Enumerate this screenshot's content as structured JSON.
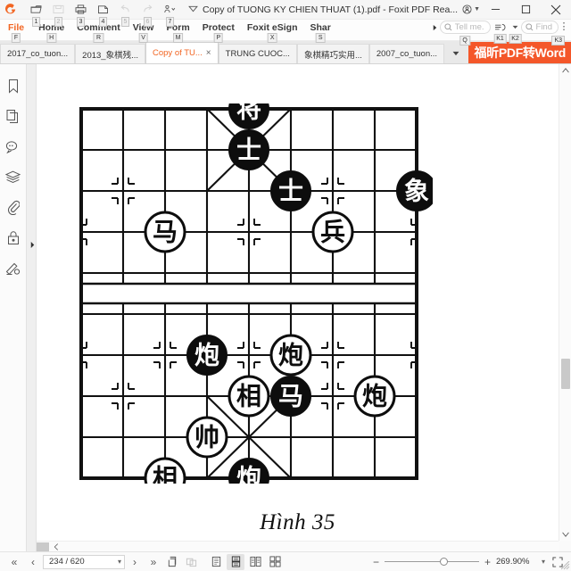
{
  "window": {
    "title": "Copy of TUONG KY CHIEN THUAT (1).pdf - Foxit PDF Rea...",
    "logo": "foxit-logo",
    "minimize": "—",
    "maximize": "□",
    "close": "×"
  },
  "quick_access": [
    {
      "name": "open-file",
      "keytip": "1",
      "enabled": true
    },
    {
      "name": "save-as",
      "keytip": "2",
      "enabled": false
    },
    {
      "name": "print",
      "keytip": "3",
      "enabled": true
    },
    {
      "name": "email",
      "keytip": "4",
      "enabled": true
    },
    {
      "name": "undo",
      "keytip": "5",
      "enabled": false
    },
    {
      "name": "redo",
      "keytip": "6",
      "enabled": false
    },
    {
      "name": "customize",
      "keytip": "7",
      "enabled": true
    }
  ],
  "menu": {
    "items": [
      {
        "label": "File",
        "keytip": "F",
        "active": true
      },
      {
        "label": "Home",
        "keytip": "H",
        "active": false
      },
      {
        "label": "Comment",
        "keytip": "R",
        "active": false
      },
      {
        "label": "View",
        "keytip": "V",
        "active": false
      },
      {
        "label": "Form",
        "keytip": "M",
        "active": false
      },
      {
        "label": "Protect",
        "keytip": "P",
        "active": false
      },
      {
        "label": "Foxit eSign",
        "keytip": "X",
        "active": false
      },
      {
        "label": "Shar",
        "keytip": "S",
        "active": false
      }
    ],
    "tell_me": {
      "placeholder": "Tell me.",
      "keytip": "Q"
    },
    "share_icon_keytip": "K1",
    "share_dropdown_keytip": "K2",
    "find": {
      "placeholder": "Find",
      "keytip": "K3"
    },
    "overflow": "⋮"
  },
  "tabs": {
    "items": [
      {
        "label": "2017_co_tuon...",
        "active": false,
        "closable": false
      },
      {
        "label": "2013_象棋残...",
        "active": false,
        "closable": false
      },
      {
        "label": "Copy of TU...",
        "active": true,
        "closable": true
      },
      {
        "label": "TRUNG CUOC...",
        "active": false,
        "closable": false
      },
      {
        "label": "象棋精巧实用...",
        "active": false,
        "closable": false
      },
      {
        "label": "2007_co_tuon...",
        "active": false,
        "closable": false
      }
    ],
    "close_glyph": "×",
    "dropdown_glyph": "▼",
    "promo_label": "福昕PDF转Word",
    "promo_color": "#f4572a"
  },
  "sidebar": {
    "items": [
      {
        "name": "bookmark-icon",
        "label": "Bookmarks"
      },
      {
        "name": "pages-icon",
        "label": "Page Thumbnails"
      },
      {
        "name": "comment-icon",
        "label": "Comments"
      },
      {
        "name": "layers-icon",
        "label": "Layers"
      },
      {
        "name": "attachment-icon",
        "label": "Attachments"
      },
      {
        "name": "lock-icon",
        "label": "Security"
      },
      {
        "name": "signature-icon",
        "label": "Digital Signatures"
      }
    ],
    "expand_glyph": "▶"
  },
  "document": {
    "caption": "Hình 35",
    "figure_title": "Hình 35"
  },
  "chart_data": {
    "type": "diagram",
    "title": "Hình 35",
    "description": "Xiangqi (Chinese chess) board position diagram",
    "board": {
      "files": 9,
      "ranks": 10,
      "river": true
    },
    "pieces": [
      {
        "char": "将",
        "side": "black",
        "filled": true,
        "file": 4,
        "rank": 0,
        "role": "general"
      },
      {
        "char": "士",
        "side": "black",
        "filled": true,
        "file": 4,
        "rank": 1,
        "role": "advisor"
      },
      {
        "char": "士",
        "side": "black",
        "filled": true,
        "file": 5,
        "rank": 2,
        "role": "advisor"
      },
      {
        "char": "象",
        "side": "black",
        "filled": true,
        "file": 8,
        "rank": 2,
        "role": "elephant"
      },
      {
        "char": "马",
        "side": "red",
        "filled": false,
        "file": 2,
        "rank": 3,
        "role": "horse"
      },
      {
        "char": "兵",
        "side": "red",
        "filled": false,
        "file": 6,
        "rank": 3,
        "role": "soldier"
      },
      {
        "char": "炮",
        "side": "black",
        "filled": true,
        "file": 3,
        "rank": 6,
        "role": "cannon"
      },
      {
        "char": "炮",
        "side": "red",
        "filled": false,
        "file": 5,
        "rank": 6,
        "role": "cannon"
      },
      {
        "char": "相",
        "side": "red",
        "filled": false,
        "file": 4,
        "rank": 7,
        "role": "minister"
      },
      {
        "char": "马",
        "side": "black",
        "filled": true,
        "file": 5,
        "rank": 7,
        "role": "horse"
      },
      {
        "char": "炮",
        "side": "red",
        "filled": false,
        "file": 7,
        "rank": 7,
        "role": "cannon"
      },
      {
        "char": "帅",
        "side": "red",
        "filled": false,
        "file": 3,
        "rank": 8,
        "role": "marshal"
      },
      {
        "char": "相",
        "side": "red",
        "filled": false,
        "file": 2,
        "rank": 9,
        "role": "minister"
      },
      {
        "char": "炮",
        "side": "black",
        "filled": true,
        "file": 4,
        "rank": 9,
        "role": "cannon"
      }
    ]
  },
  "status": {
    "first_page": "«",
    "prev_page": "‹",
    "page_value": "234 / 620",
    "page_dropdown": "▾",
    "next_page": "›",
    "last_page": "»",
    "snapshot": "snapshot-icon",
    "compare": "compare-icon",
    "view_modes": [
      {
        "name": "single-page-view",
        "active": false
      },
      {
        "name": "continuous-page-view",
        "active": true
      },
      {
        "name": "facing-page-view",
        "active": false
      },
      {
        "name": "facing-continuous-view",
        "active": false
      }
    ],
    "zoom_out": "−",
    "zoom_in": "+",
    "zoom_level": "269.90%",
    "zoom_dropdown": "▾",
    "fullscreen": "fullscreen-icon"
  }
}
